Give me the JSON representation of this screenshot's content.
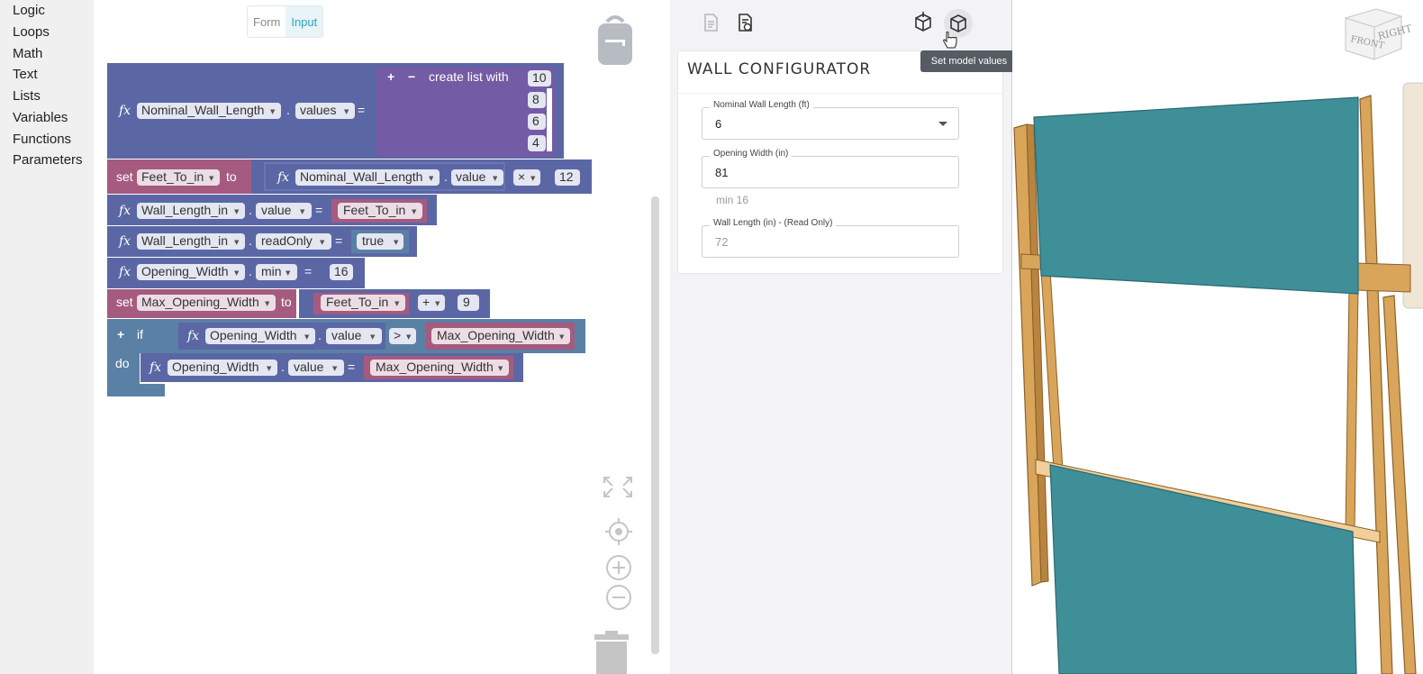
{
  "toolbox": {
    "categories": [
      "Logic",
      "Loops",
      "Math",
      "Text",
      "Lists",
      "Variables",
      "Functions",
      "Parameters"
    ]
  },
  "workspace_tabs": [
    "Form",
    "Input"
  ],
  "blocks": {
    "b1": {
      "fx": "fx",
      "param": "Nominal_Wall_Length",
      "dot": ".",
      "prop": "values",
      "eq": "=",
      "list_label": "create list with",
      "plus": "+",
      "minus": "−",
      "items": [
        "10",
        "8",
        "6",
        "4"
      ]
    },
    "b2": {
      "kw": "set",
      "var": "Feet_To_in",
      "to": "to",
      "fx": "fx",
      "param": "Nominal_Wall_Length",
      "dot": ".",
      "prop": "value",
      "op": "×",
      "num": "12"
    },
    "b3": {
      "fx": "fx",
      "param": "Wall_Length_in",
      "dot": ".",
      "prop": "value",
      "eq": "=",
      "var": "Feet_To_in"
    },
    "b4": {
      "fx": "fx",
      "param": "Wall_Length_in",
      "dot": ".",
      "prop": "readOnly",
      "eq": "=",
      "bool": "true"
    },
    "b5": {
      "fx": "fx",
      "param": "Opening_Width",
      "dot": ".",
      "prop": "min",
      "eq": "=",
      "num": "16"
    },
    "b6": {
      "kw": "set",
      "var": "Max_Opening_Width",
      "to": "to",
      "var2": "Feet_To_in",
      "op": "+",
      "num": "9"
    },
    "b7": {
      "plus": "+",
      "kw": "if",
      "do": "do",
      "fx": "fx",
      "param": "Opening_Width",
      "dot": ".",
      "prop": "value",
      "op": ">",
      "var": "Max_Opening_Width"
    },
    "b8": {
      "fx": "fx",
      "param": "Opening_Width",
      "dot": ".",
      "prop": "value",
      "eq": "=",
      "var": "Max_Opening_Width"
    }
  },
  "panel": {
    "title": "WALL CONFIGURATOR",
    "tooltip": "Set model values",
    "fields": [
      {
        "label": "Nominal Wall Length (ft)",
        "value": "6"
      },
      {
        "label": "Opening Width (in)",
        "value": "81",
        "hint": "min 16"
      },
      {
        "label": "Wall Length (in) - (Read Only)",
        "value": "72"
      }
    ]
  },
  "viewcube": {
    "front": "FRONT",
    "right": "RIGHT"
  },
  "colors": {
    "block_param": "#5b67a5",
    "block_var": "#a55b80",
    "block_list": "#745ba5",
    "block_if": "#5b80a5",
    "panel_teal": "#3f8f99",
    "stud_wood": "#d9a55a",
    "accent": "#2aa3c9"
  }
}
